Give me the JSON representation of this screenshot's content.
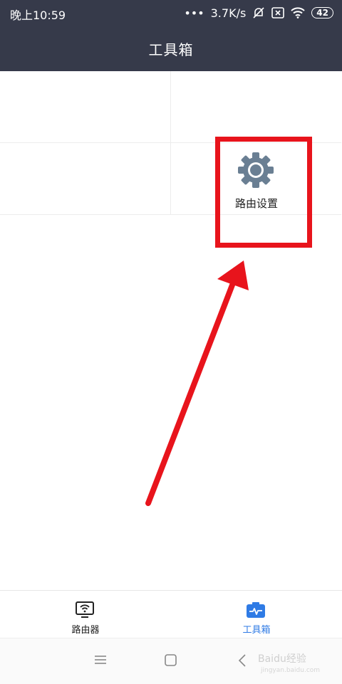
{
  "status_bar": {
    "time": "晚上10:59",
    "dots": "•••",
    "speed": "3.7K/s",
    "battery": "42"
  },
  "header": {
    "title": "工具箱"
  },
  "tools": [
    {
      "label": "",
      "icon": ""
    },
    {
      "label": "",
      "icon": ""
    },
    {
      "label": "",
      "icon": ""
    },
    {
      "label": "路由设置",
      "icon": "gear-icon"
    }
  ],
  "bottom_nav": {
    "items": [
      {
        "label": "路由器",
        "icon": "router-icon",
        "active": false
      },
      {
        "label": "工具箱",
        "icon": "toolbox-icon",
        "active": true
      }
    ]
  },
  "system_nav": {
    "watermark": "Baidu经验",
    "watermark_sub": "jingyan.baidu.com"
  },
  "colors": {
    "header_bg": "#363a4a",
    "active": "#2f7be5",
    "highlight": "#e8141c",
    "gear": "#6a7f93"
  }
}
